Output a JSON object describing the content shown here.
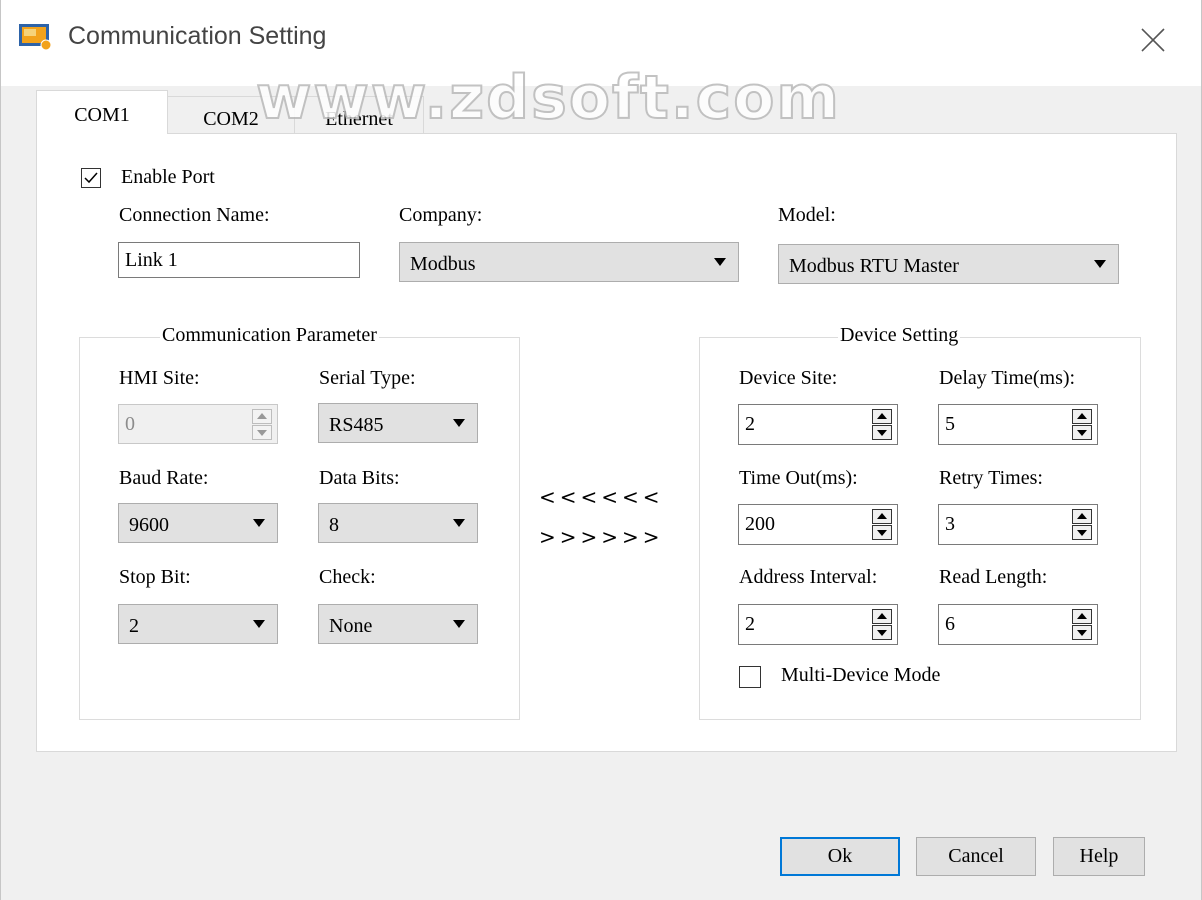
{
  "window": {
    "title": "Communication Setting",
    "watermark": "www.zdsoft.com"
  },
  "tabs": [
    {
      "label": "COM1",
      "active": true
    },
    {
      "label": "COM2",
      "active": false
    },
    {
      "label": "Ethernet",
      "active": false
    }
  ],
  "enable_port": {
    "label": "Enable Port",
    "checked": true
  },
  "connection": {
    "name_label": "Connection Name:",
    "name_value": "Link 1",
    "company_label": "Company:",
    "company_value": "Modbus",
    "model_label": "Model:",
    "model_value": "Modbus RTU Master"
  },
  "comm_param": {
    "title": "Communication Parameter",
    "hmi_site_label": "HMI Site:",
    "hmi_site_value": "0",
    "serial_type_label": "Serial Type:",
    "serial_type_value": "RS485",
    "baud_rate_label": "Baud Rate:",
    "baud_rate_value": "9600",
    "data_bits_label": "Data Bits:",
    "data_bits_value": "8",
    "stop_bit_label": "Stop Bit:",
    "stop_bit_value": "2",
    "check_label": "Check:",
    "check_value": "None"
  },
  "transfer": {
    "left_arrows": "<<<<<<",
    "right_arrows": ">>>>>>"
  },
  "device_setting": {
    "title": "Device Setting",
    "device_site_label": "Device Site:",
    "device_site_value": "2",
    "delay_time_label": "Delay Time(ms):",
    "delay_time_value": "5",
    "time_out_label": "Time Out(ms):",
    "time_out_value": "200",
    "retry_times_label": "Retry Times:",
    "retry_times_value": "3",
    "address_interval_label": "Address Interval:",
    "address_interval_value": "2",
    "read_length_label": "Read Length:",
    "read_length_value": "6",
    "multi_device_label": "Multi-Device Mode",
    "multi_device_checked": false
  },
  "buttons": {
    "ok": "Ok",
    "cancel": "Cancel",
    "help": "Help"
  },
  "colors": {
    "accent": "#0078d7",
    "icon_orange": "#f2a21b",
    "icon_blue": "#2d63a8"
  }
}
